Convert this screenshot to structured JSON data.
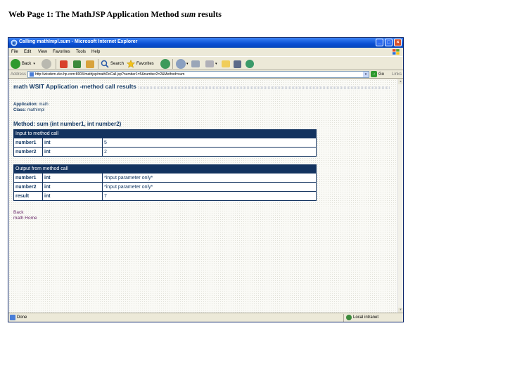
{
  "document": {
    "heading_prefix": "Web Page 1: The MathJSP Application Method ",
    "heading_em": "sum",
    "heading_suffix": " results"
  },
  "window": {
    "title": "Calling mathImpl.sum - Microsoft Internet Explorer",
    "menu": [
      "File",
      "Edit",
      "View",
      "Favorites",
      "Tools",
      "Help"
    ],
    "toolbar": {
      "back": "Back",
      "search": "Search",
      "favorites": "Favorites"
    },
    "address": {
      "label": "Address",
      "url": "http://wisdem.zko.hp.com:8004/mathjsp/mathDoCall.jsp?number1=5&number2=2&Method=sum",
      "go": "Go",
      "links": "Links"
    },
    "status": {
      "text": "Done",
      "zone": "Local intranet"
    }
  },
  "page": {
    "title": "math WSIT Application -method call results",
    "application_label": "Application:",
    "application_value": "math",
    "class_label": "Class:",
    "class_value": "mathImpl",
    "method_heading": "Method: sum (int number1, int number2)",
    "input_table": {
      "header": "Input to method call",
      "rows": [
        {
          "name": "number1",
          "type": "int",
          "value": "5"
        },
        {
          "name": "number2",
          "type": "int",
          "value": "2"
        }
      ]
    },
    "output_table": {
      "header": "Output from method call",
      "rows": [
        {
          "name": "number1",
          "type": "int",
          "value": "*input parameter only*"
        },
        {
          "name": "number2",
          "type": "int",
          "value": "*input parameter only*"
        },
        {
          "name": "result",
          "type": "int",
          "value": "7"
        }
      ]
    },
    "links": {
      "back": "Back",
      "home": "math Home"
    }
  }
}
